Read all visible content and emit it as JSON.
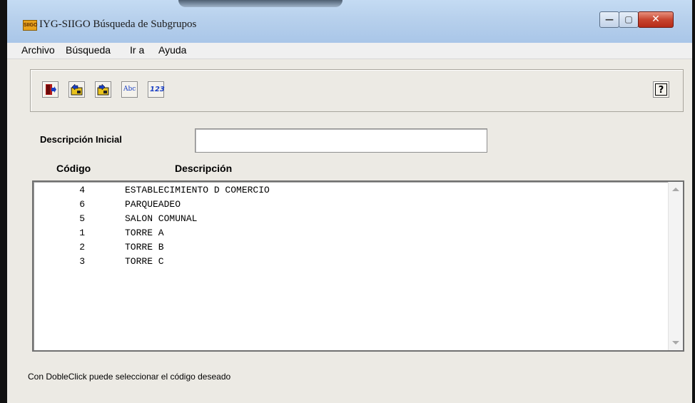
{
  "window": {
    "title": "IYG-SIIGO Búsqueda de Subgrupos",
    "app_icon_text": "SIIGO",
    "controls": {
      "minimize": "—",
      "maximize": "▢",
      "close": "✕"
    }
  },
  "menubar": {
    "items": [
      {
        "label": "Archivo"
      },
      {
        "label": "Búsqueda"
      },
      {
        "label": "Ir a"
      },
      {
        "label": "Ayuda"
      }
    ]
  },
  "toolbar": {
    "buttons": [
      {
        "icon": "exit-door-icon"
      },
      {
        "icon": "folder-previous-icon"
      },
      {
        "icon": "folder-next-icon"
      },
      {
        "icon": "abc-search-icon",
        "text": "Abc"
      },
      {
        "icon": "numeric-search-icon",
        "text": "123"
      }
    ],
    "help": {
      "icon": "help-question-icon",
      "text": "?"
    }
  },
  "search": {
    "label": "Descripción Inicial",
    "value": "",
    "placeholder": ""
  },
  "list": {
    "columns": [
      "Código",
      "Descripción"
    ],
    "rows": [
      {
        "code": "4",
        "description": "ESTABLECIMIENTO D COMERCIO"
      },
      {
        "code": "6",
        "description": "PARQUEADEO"
      },
      {
        "code": "5",
        "description": "SALON COMUNAL"
      },
      {
        "code": "1",
        "description": "TORRE A"
      },
      {
        "code": "2",
        "description": "TORRE B"
      },
      {
        "code": "3",
        "description": "TORRE C"
      }
    ]
  },
  "status": {
    "text": "Con DobleClick puede seleccionar el código deseado"
  },
  "colors": {
    "titlebar": "#b7d0ec",
    "close_button": "#c8452f",
    "client_bg": "#eceae4",
    "toolbar_icon_blue": "#1a3fc4"
  }
}
